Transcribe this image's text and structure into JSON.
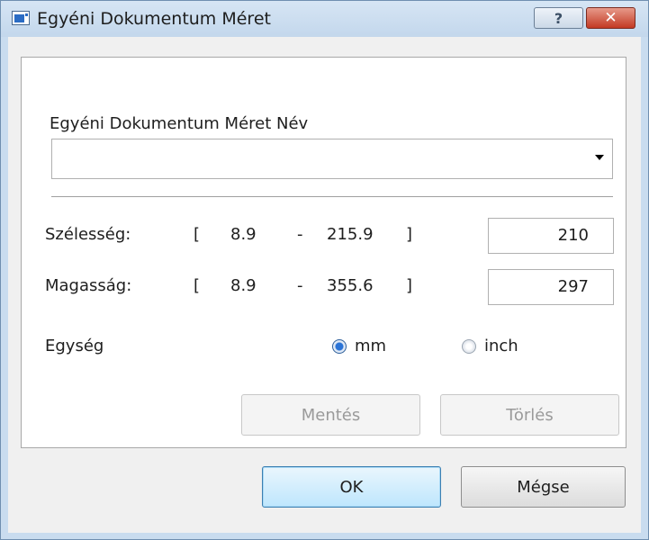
{
  "window": {
    "title": "Egyéni Dokumentum Méret",
    "help_label": "?",
    "close_label": "✕"
  },
  "form": {
    "name_label": "Egyéni Dokumentum Méret Név",
    "name_value": "",
    "width": {
      "label": "Szélesség:",
      "bracket_open": "[",
      "min": "8.9",
      "dash": "-",
      "max": "215.9",
      "bracket_close": "]",
      "value": "210"
    },
    "height": {
      "label": "Magasság:",
      "bracket_open": "[",
      "min": "8.9",
      "dash": "-",
      "max": "355.6",
      "bracket_close": "]",
      "value": "297"
    },
    "unit": {
      "label": "Egység",
      "options": [
        {
          "label": "mm",
          "selected": true
        },
        {
          "label": "inch",
          "selected": false
        }
      ]
    },
    "save_label": "Mentés",
    "delete_label": "Törlés"
  },
  "footer": {
    "ok_label": "OK",
    "cancel_label": "Mégse"
  }
}
